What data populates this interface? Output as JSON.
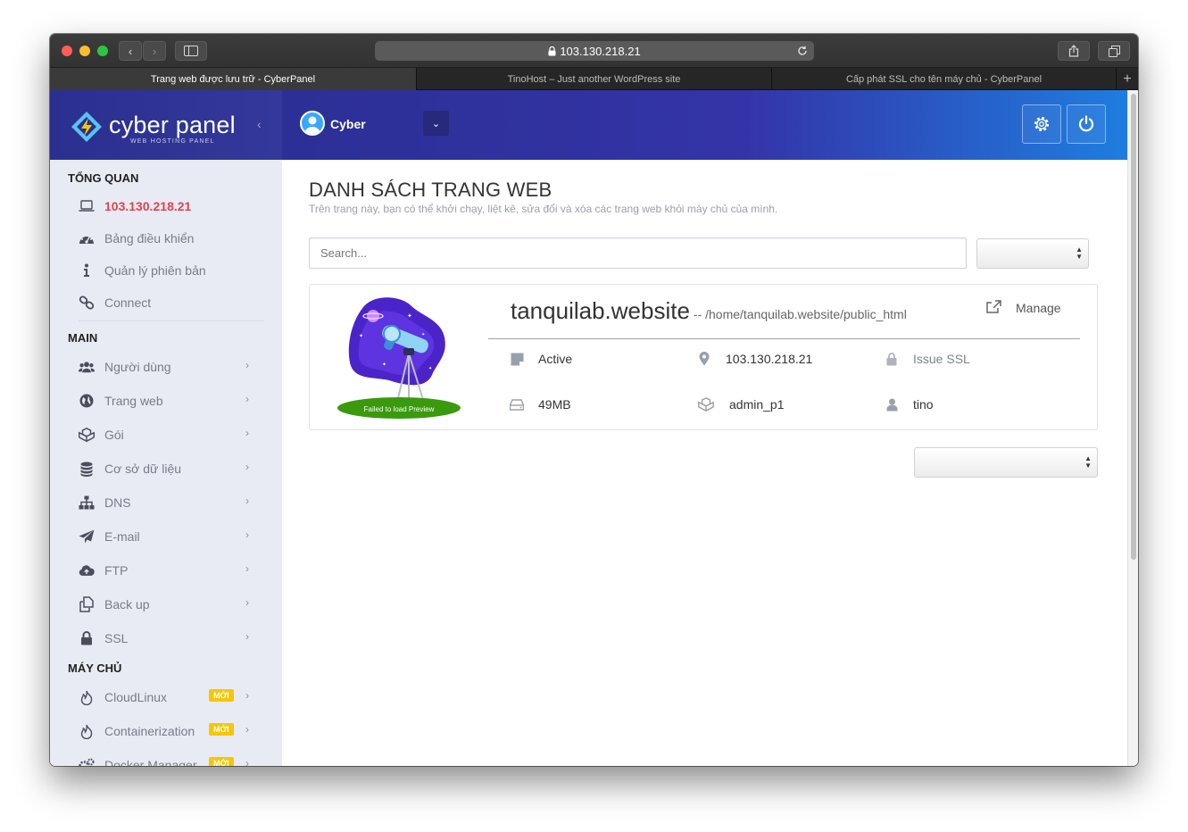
{
  "browser": {
    "address": "103.130.218.21",
    "tabs": [
      {
        "label": "Trang web được lưu trữ - CyberPanel",
        "active": true
      },
      {
        "label": "TinoHost – Just another WordPress site",
        "active": false
      },
      {
        "label": "Cấp phát SSL cho tên máy chủ - CyberPanel",
        "active": false
      }
    ]
  },
  "logo": {
    "text": "cyber panel",
    "subtitle": "WEB HOSTING PANEL"
  },
  "sidebar": {
    "sections": [
      {
        "title": "TỔNG QUAN",
        "items": [
          {
            "label": "103.130.218.21",
            "icon": "laptop-icon",
            "active": true
          },
          {
            "label": "Bảng điều khiển",
            "icon": "dashboard-icon"
          },
          {
            "label": "Quản lý phiên bản",
            "icon": "info-icon"
          },
          {
            "label": "Connect",
            "icon": "link-icon"
          }
        ]
      },
      {
        "title": "MAIN",
        "items": [
          {
            "label": "Người dùng",
            "icon": "users-icon"
          },
          {
            "label": "Trang web",
            "icon": "globe-icon"
          },
          {
            "label": "Gói",
            "icon": "cubes-icon"
          },
          {
            "label": "Cơ sở dữ liệu",
            "icon": "database-icon"
          },
          {
            "label": "DNS",
            "icon": "sitemap-icon"
          },
          {
            "label": "E-mail",
            "icon": "paper-plane-icon"
          },
          {
            "label": "FTP",
            "icon": "cloud-upload-icon"
          },
          {
            "label": "Back up",
            "icon": "copy-icon"
          },
          {
            "label": "SSL",
            "icon": "lock-icon"
          }
        ]
      },
      {
        "title": "MÁY CHỦ",
        "items": [
          {
            "label": "CloudLinux",
            "icon": "flame-icon",
            "badge": "MỚI"
          },
          {
            "label": "Containerization",
            "icon": "flame-icon",
            "badge": "MỚI"
          },
          {
            "label": "Docker Manager",
            "icon": "gears-icon",
            "badge": "MỚI"
          }
        ]
      }
    ]
  },
  "topbar": {
    "user": "Cyber"
  },
  "main": {
    "title": "DANH SÁCH TRANG WEB",
    "subtitle": "Trên trang này, bạn có thể khởi chạy, liệt kê, sửa đổi và xóa các trang web khỏi máy chủ của mình.",
    "search_placeholder": "Search..."
  },
  "website": {
    "domain": "tanquilab.website",
    "path": "-- /home/tanquilab.website/public_html",
    "manage": "Manage",
    "preview_caption": "Failed to load Preview",
    "status": "Active",
    "ip": "103.130.218.21",
    "ssl": "Issue SSL",
    "disk": "49MB",
    "package": "admin_p1",
    "owner": "tino"
  },
  "colors": {
    "accent": "#e0424f",
    "topbar_start": "#2c2f95",
    "topbar_end": "#1f7de0",
    "badge": "#f6c700"
  }
}
